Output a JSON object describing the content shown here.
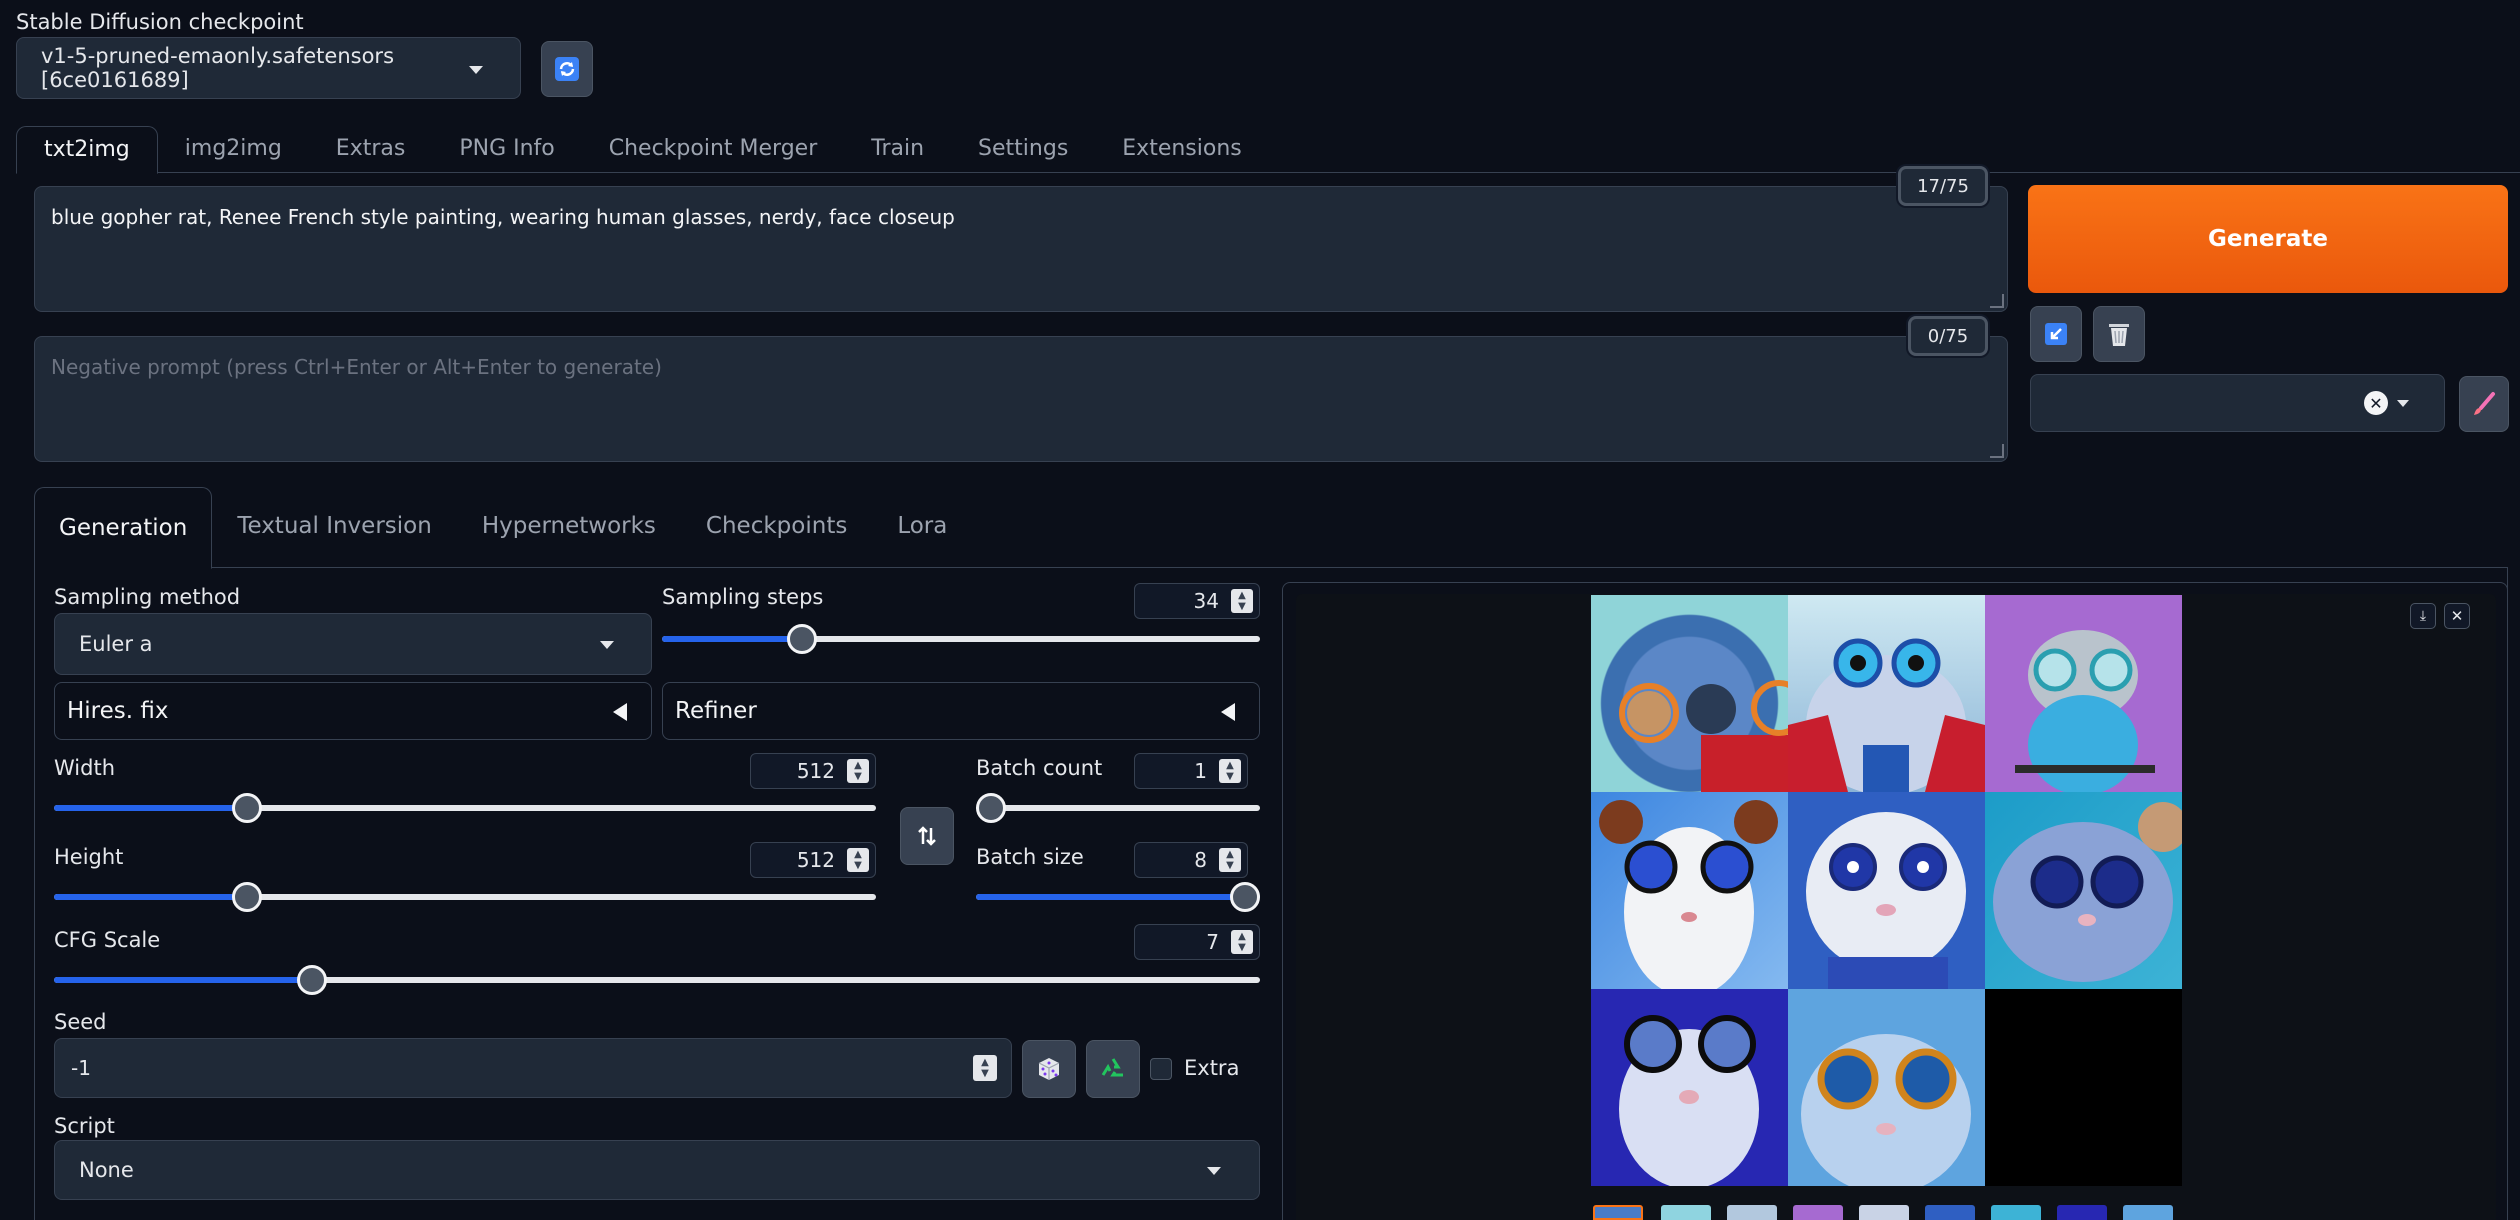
{
  "checkpoint": {
    "label": "Stable Diffusion checkpoint",
    "value": "v1-5-pruned-emaonly.safetensors [6ce0161689]",
    "refresh_icon": "refresh-icon"
  },
  "tabs": [
    "txt2img",
    "img2img",
    "Extras",
    "PNG Info",
    "Checkpoint Merger",
    "Train",
    "Settings",
    "Extensions"
  ],
  "prompt": {
    "value": "blue gopher rat, Renee French style painting, wearing human glasses, nerdy, face closeup",
    "token_count": "17/75"
  },
  "negative_prompt": {
    "placeholder": "Negative prompt (press Ctrl+Enter or Alt+Enter to generate)",
    "token_count": "0/75"
  },
  "generate_button": "Generate",
  "style_select": {
    "value": ""
  },
  "subtabs": [
    "Generation",
    "Textual Inversion",
    "Hypernetworks",
    "Checkpoints",
    "Lora"
  ],
  "sampling_method": {
    "label": "Sampling method",
    "value": "Euler a"
  },
  "sampling_steps": {
    "label": "Sampling steps",
    "value": "34",
    "fraction": 0.227
  },
  "hires_fix": "Hires. fix",
  "refiner": "Refiner",
  "width": {
    "label": "Width",
    "value": "512",
    "fraction": 0.234
  },
  "height": {
    "label": "Height",
    "value": "512",
    "fraction": 0.234
  },
  "batch_count": {
    "label": "Batch count",
    "value": "1",
    "fraction": 0.0
  },
  "batch_size": {
    "label": "Batch size",
    "value": "8",
    "fraction": 1.0
  },
  "cfg_scale": {
    "label": "CFG Scale",
    "value": "7",
    "fraction": 0.214
  },
  "seed": {
    "label": "Seed",
    "value": "-1",
    "extra_label": "Extra"
  },
  "script": {
    "label": "Script",
    "value": "None"
  },
  "colors": {
    "accent": "#2563eb",
    "generate": "#f97316",
    "background": "#0b0f19"
  }
}
